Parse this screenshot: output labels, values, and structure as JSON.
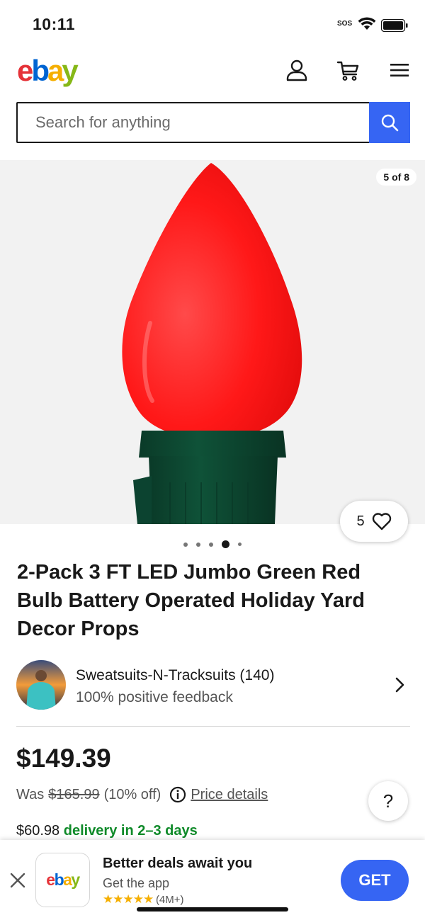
{
  "status_bar": {
    "time": "10:11",
    "sos": "SOS"
  },
  "header": {
    "logo_letters": [
      {
        "char": "e",
        "color": "#e53238"
      },
      {
        "char": "b",
        "color": "#0064d2"
      },
      {
        "char": "a",
        "color": "#f5af02"
      },
      {
        "char": "y",
        "color": "#86b817"
      }
    ],
    "icons": [
      "user-icon",
      "cart-icon",
      "menu-icon"
    ]
  },
  "search": {
    "placeholder": "Search for anything"
  },
  "gallery": {
    "counter": "5 of 8",
    "watch_count": "5",
    "dots_count": 5,
    "active_dot": 4
  },
  "listing": {
    "title": "2-Pack 3 FT LED Jumbo Green Red Bulb Battery Operated Holiday Yard Decor Props"
  },
  "seller": {
    "name": "Sweatsuits-N-Tracksuits (140)",
    "feedback": "100% positive feedback"
  },
  "pricing": {
    "price": "$149.39",
    "was_label": "Was",
    "was_price": "$165.99",
    "discount": "(10% off)",
    "price_details": "Price details",
    "help": "?"
  },
  "delivery": {
    "cost": "$60.98",
    "text": "delivery in 2–3 days"
  },
  "app_banner": {
    "logo": "ebay",
    "title": "Better deals await you",
    "subtitle": "Get the app",
    "stars": "★★★★★",
    "rating_count": "(4M+)",
    "cta": "GET"
  },
  "colors": {
    "accent": "#3665f3",
    "delivery_green": "#0f8a29",
    "bulb_red": "#ff1f1f",
    "socket_green": "#0d4a33"
  }
}
